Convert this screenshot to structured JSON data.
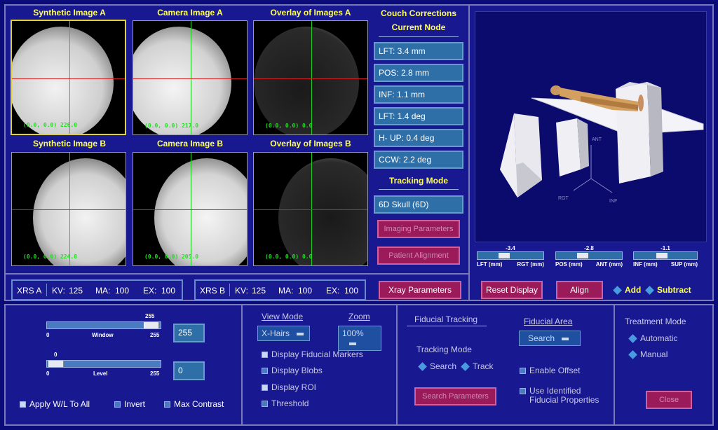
{
  "images": [
    {
      "title": "Synthetic Image A",
      "coord": "(0.0, 0.0) 226.0"
    },
    {
      "title": "Camera Image A",
      "coord": "(0.0, 0.0) 217.0"
    },
    {
      "title": "Overlay of Images A",
      "coord": "(0.0, 0.0) 0.0"
    },
    {
      "title": "Synthetic Image B",
      "coord": "(0.0, 0.0) 224.8"
    },
    {
      "title": "Camera Image B",
      "coord": "(0.0, 0.0) 205.0"
    },
    {
      "title": "Overlay of Images B",
      "coord": "(0.0, 0.0) 0.0"
    }
  ],
  "couch": {
    "title": "Couch Corrections",
    "subtitle": "Current Node",
    "values": [
      "LFT: 3.4 mm",
      "POS: 2.8 mm",
      "INF: 1.1 mm",
      "LFT: 1.4 deg",
      "H- UP: 0.4 deg",
      "CCW: 2.2 deg"
    ],
    "tracking_title": "Tracking Mode",
    "tracking_value": "6D Skull (6D)",
    "imaging_params": "Imaging Parameters",
    "patient_align": "Patient Alignment",
    "xray_params": "Xray Parameters"
  },
  "xrsA": {
    "label": "XRS A",
    "kv_label": "KV:",
    "kv": "125",
    "ma_label": "MA:",
    "ma": "100",
    "ex_label": "EX:",
    "ex": "100"
  },
  "xrsB": {
    "label": "XRS B",
    "kv_label": "KV:",
    "kv": "125",
    "ma_label": "MA:",
    "ma": "100",
    "ex_label": "EX:",
    "ex": "100"
  },
  "scene": {
    "ant": "ANT",
    "rgt": "RGT",
    "inf": "INF"
  },
  "mini_sliders": [
    {
      "value": "-3.4",
      "left": "LFT (mm)",
      "right": "RGT (mm)"
    },
    {
      "value": "-2.8",
      "left": "POS (mm)",
      "right": "ANT (mm)"
    },
    {
      "value": "-1.1",
      "left": "INF (mm)",
      "right": "SUP (mm)"
    }
  ],
  "view_buttons": {
    "reset": "Reset Display",
    "align": "Align",
    "add": "Add",
    "subtract": "Subtract"
  },
  "window": {
    "top": "255",
    "min": "0",
    "label": "Window",
    "max": "255",
    "value": "255"
  },
  "level": {
    "top": "0",
    "min": "0",
    "label": "Level",
    "max": "255",
    "value": "0"
  },
  "checks_left": {
    "apply": "Apply W/L To All",
    "invert": "Invert",
    "maxc": "Max Contrast"
  },
  "view": {
    "view_mode_label": "View Mode",
    "view_mode": "X-Hairs",
    "zoom_label": "Zoom",
    "zoom": "100%",
    "opts": [
      "Display Fiducial Markers",
      "Display Blobs",
      "Display ROI",
      "Threshold"
    ]
  },
  "fiducial": {
    "title": "Fiducial Tracking",
    "area_label": "Fiducial Area",
    "area_value": "Search",
    "tracking_label": "Tracking Mode",
    "search": "Search",
    "track": "Track",
    "enable_offset": "Enable Offset",
    "use_identified_1": "Use Identified",
    "use_identified_2": "Fiducial Properties",
    "search_params": "Search Parameters"
  },
  "treatment": {
    "title": "Treatment Mode",
    "automatic": "Automatic",
    "manual": "Manual",
    "close": "Close"
  }
}
